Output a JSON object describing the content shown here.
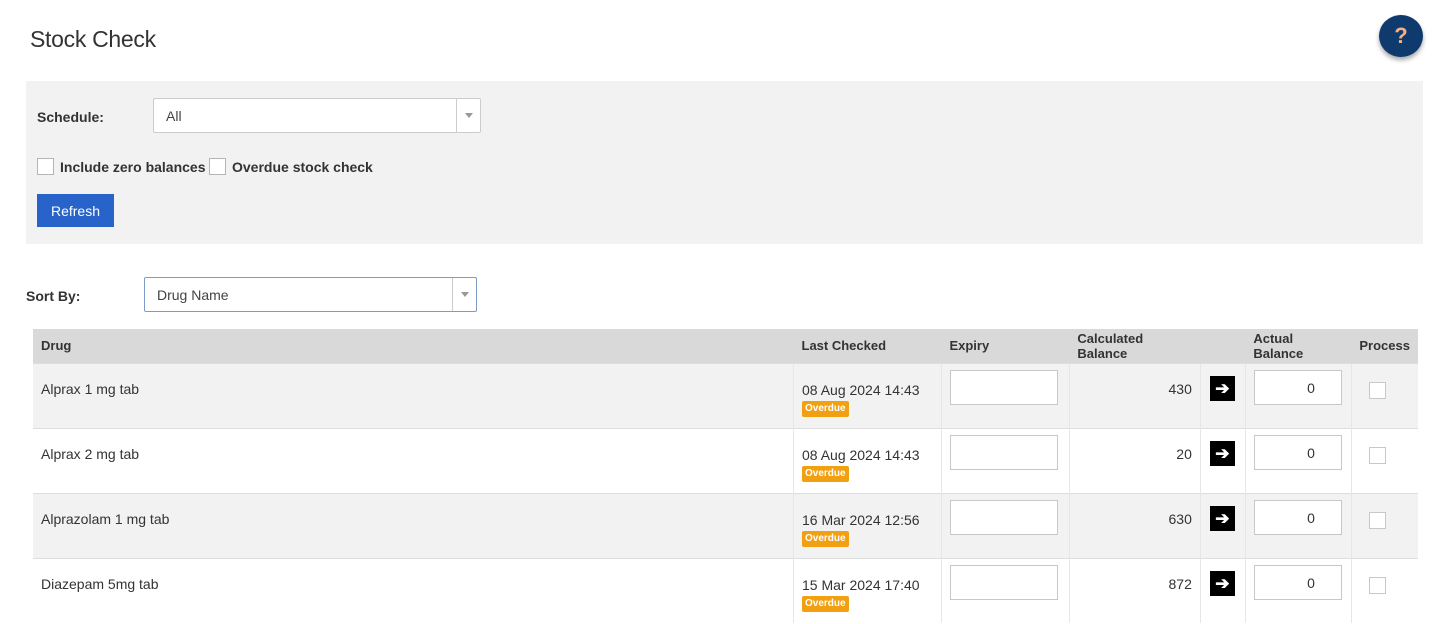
{
  "page": {
    "title": "Stock Check",
    "help_symbol": "?"
  },
  "filters": {
    "schedule_label": "Schedule:",
    "schedule_value": "All",
    "include_zero_label": "Include zero balances",
    "overdue_label": "Overdue stock check",
    "refresh_label": "Refresh"
  },
  "sort": {
    "label": "Sort By:",
    "value": "Drug Name"
  },
  "table": {
    "headers": [
      "Drug",
      "Last Checked",
      "Expiry",
      "Calculated Balance",
      "",
      "Actual Balance",
      "Process"
    ],
    "rows": [
      {
        "drug": "Alprax 1 mg tab",
        "last_checked": "08 Aug 2024 14:43",
        "badge": "Overdue",
        "calculated": "430",
        "actual": "0"
      },
      {
        "drug": "Alprax 2 mg tab",
        "last_checked": "08 Aug 2024 14:43",
        "badge": "Overdue",
        "calculated": "20",
        "actual": "0"
      },
      {
        "drug": "Alprazolam 1 mg tab",
        "last_checked": "16 Mar 2024 12:56",
        "badge": "Overdue",
        "calculated": "630",
        "actual": "0"
      },
      {
        "drug": "Diazepam 5mg tab",
        "last_checked": "15 Mar 2024 17:40",
        "badge": "Overdue",
        "calculated": "872",
        "actual": "0"
      }
    ]
  },
  "icons": {
    "help": "question-icon",
    "transfer": "arrow-right-icon",
    "dropdown": "chevron-down-icon"
  },
  "colors": {
    "primary": "#2763c8",
    "help_bg": "#0f3a6e",
    "overdue_badge": "#f0a010"
  }
}
